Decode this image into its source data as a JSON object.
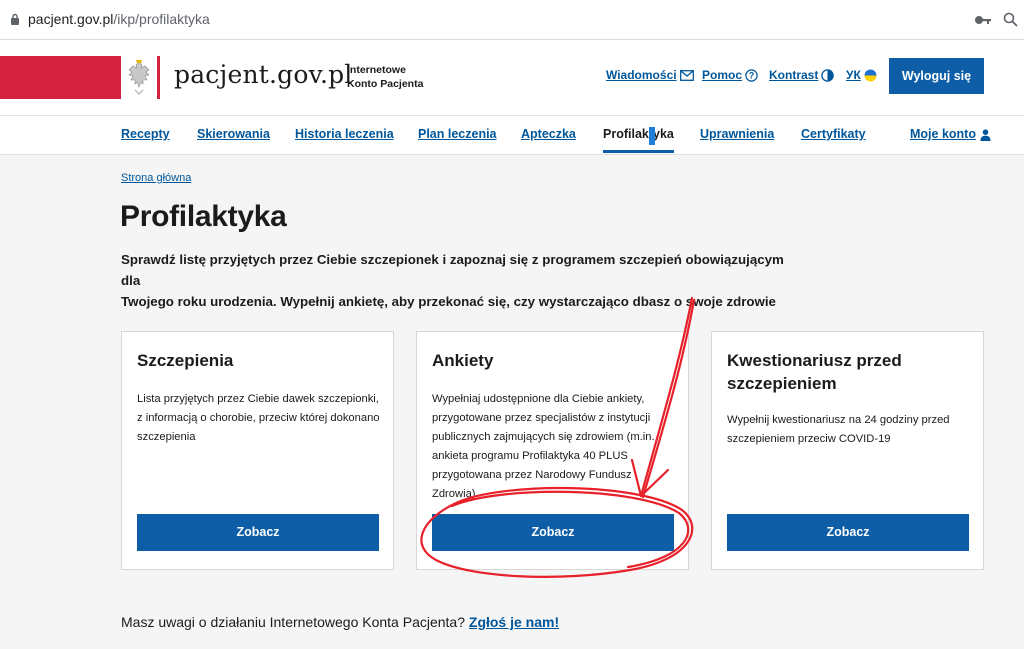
{
  "browser": {
    "url_host": "pacjent.gov.pl",
    "url_path": "/ikp/profilaktyka"
  },
  "header": {
    "brand": "pacjent.gov.pl",
    "subbrand_line1": "Internetowe",
    "subbrand_line2": "Konto Pacjenta",
    "links": {
      "news": "Wiadomości",
      "help": "Pomoc",
      "contrast": "Kontrast",
      "language": "УК"
    },
    "logout": "Wyloguj się"
  },
  "nav": {
    "items": [
      "Recepty",
      "Skierowania",
      "Historia leczenia",
      "Plan leczenia",
      "Apteczka",
      "Profilaktyka",
      "Uprawnienia",
      "Certyfikaty",
      "Moje konto"
    ],
    "active": "Profilaktyka"
  },
  "breadcrumb": "Strona główna",
  "page": {
    "title": "Profilaktyka",
    "lead_line1": "Sprawdź listę przyjętych przez Ciebie szczepionek i zapoznaj się z programem szczepień obowiązującym dla",
    "lead_line2": "Twojego roku urodzenia. Wypełnij ankietę, aby przekonać się, czy wystarczająco dbasz o swoje zdrowie"
  },
  "cards": [
    {
      "title": "Szczepienia",
      "text": "Lista przyjętych przez Ciebie dawek szczepionki, z informacją o chorobie, przeciw której dokonano szczepienia",
      "button": "Zobacz"
    },
    {
      "title": "Ankiety",
      "text": "Wypełniaj udostępnione dla Ciebie ankiety, przygotowane przez specjalistów z instytucji publicznych zajmujących się zdrowiem (m.in. ankieta programu Profilaktyka 40 PLUS przygotowana przez Narodowy Fundusz Zdrowia)",
      "button": "Zobacz"
    },
    {
      "title": "Kwestionariusz przed szczepieniem",
      "text": "Wypełnij kwestionariusz na 24 godziny przed szczepieniem przeciw COVID-19",
      "button": "Zobacz"
    }
  ],
  "feedback": {
    "text": "Masz uwagi o działaniu Internetowego Konta Pacjenta?",
    "link": "Zgłoś je nam!"
  },
  "colors": {
    "primary": "#0d5ea6",
    "link": "#00569a",
    "brand_red": "#d4213d",
    "annotation_red": "#e8202a"
  },
  "icons": {
    "lock": "lock-icon",
    "key": "key-icon",
    "zoom": "zoom-icon",
    "mail": "mail-icon",
    "help": "help-icon",
    "contrast": "contrast-icon",
    "flag": "ukraine-flag-icon",
    "user": "user-icon",
    "eagle": "polish-eagle-emblem"
  }
}
